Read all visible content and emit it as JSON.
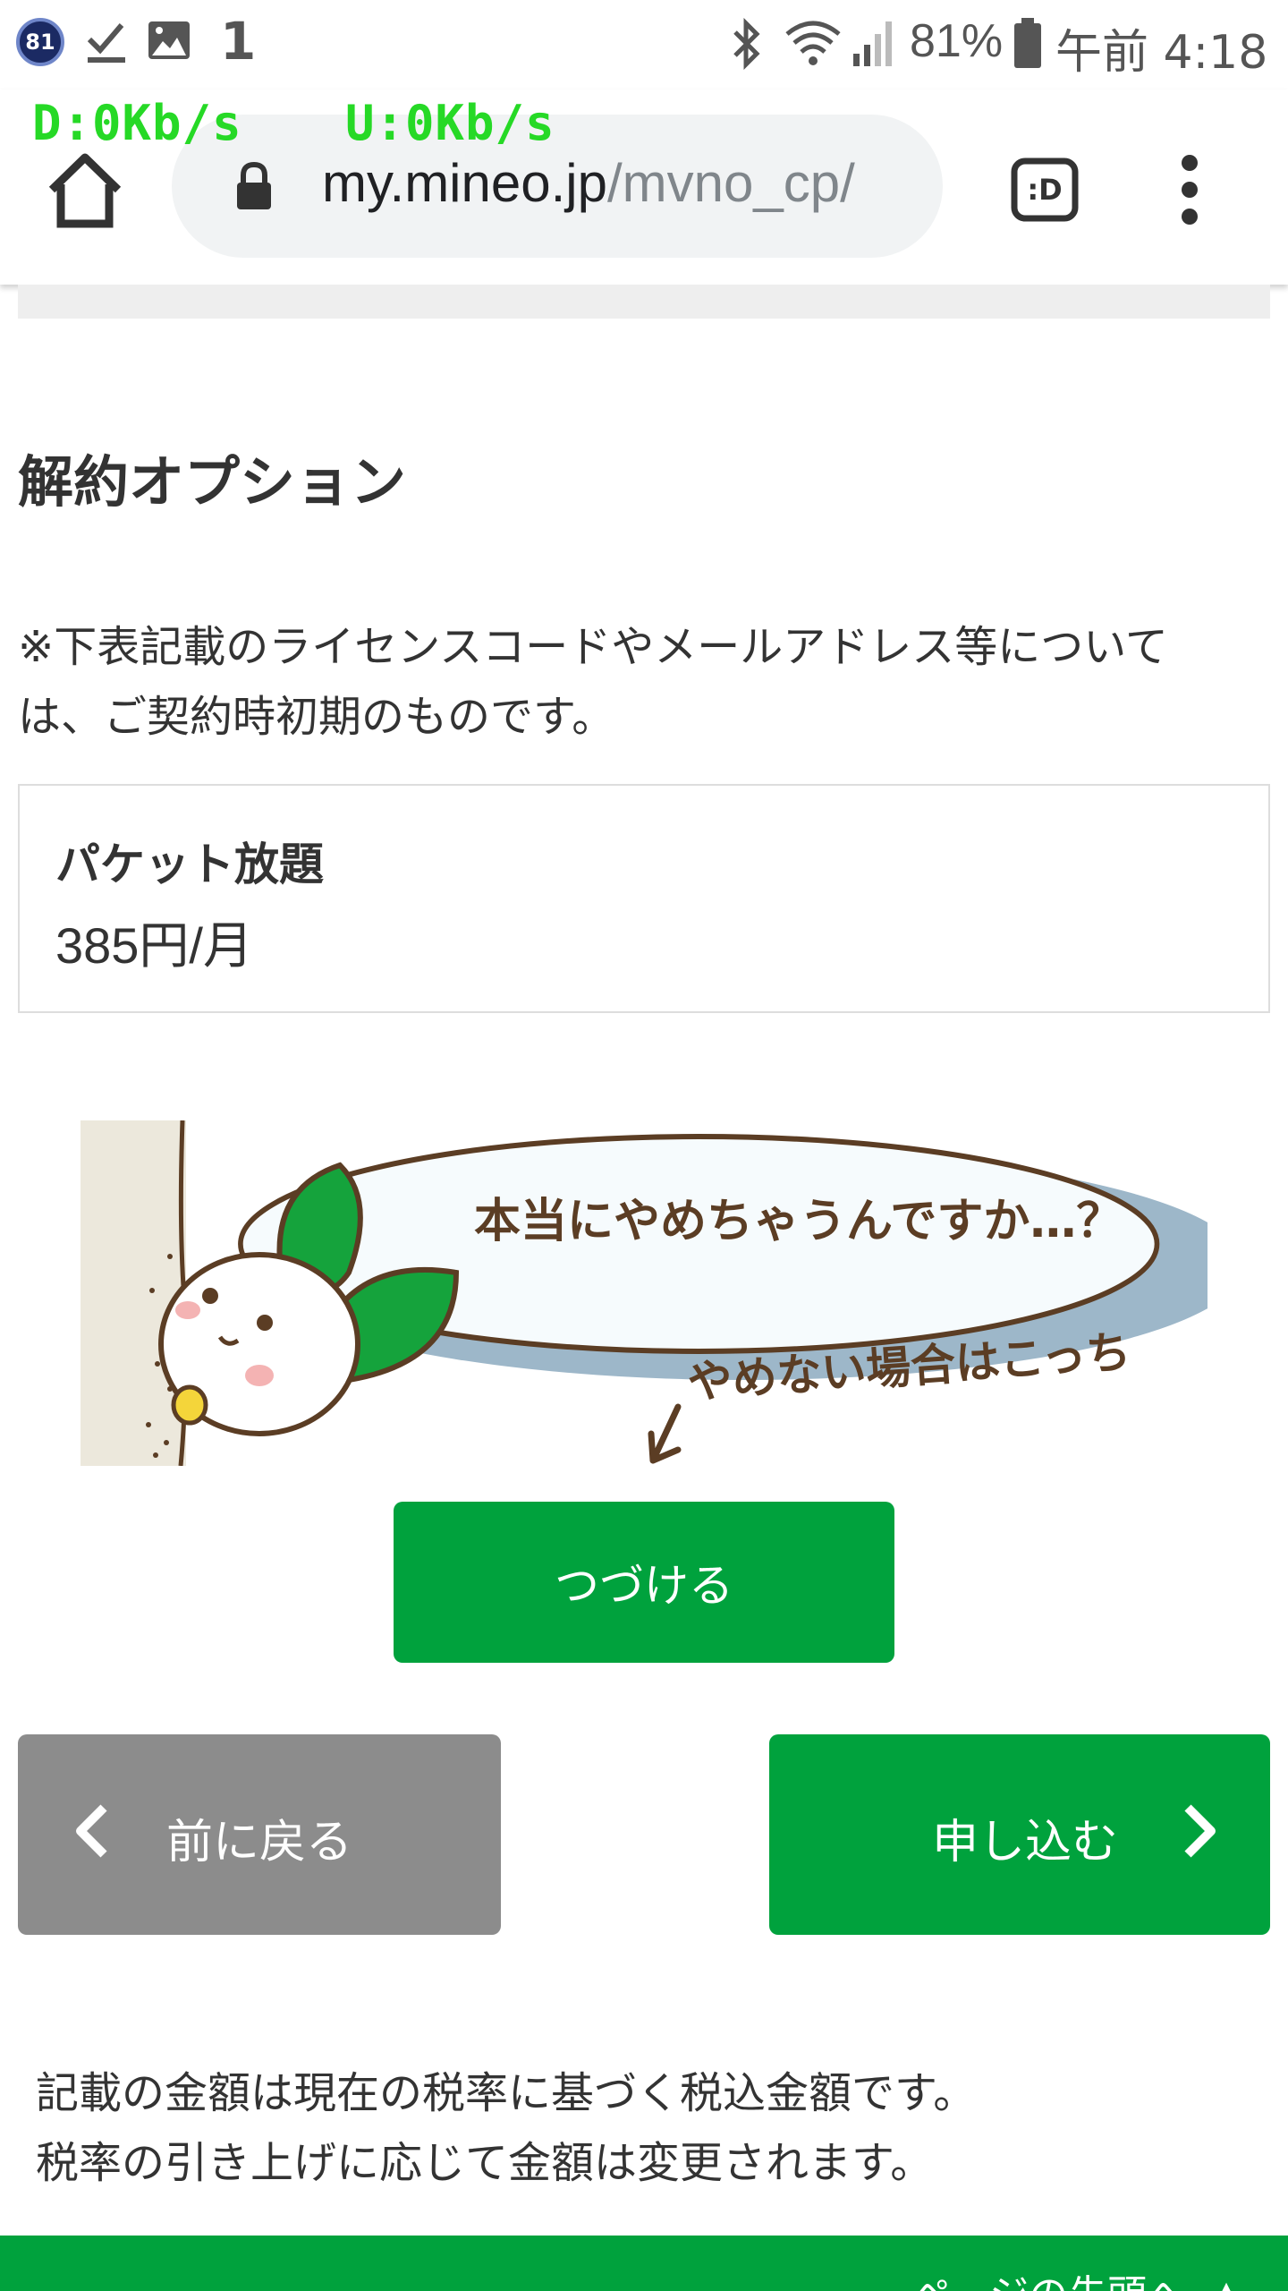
{
  "status_bar": {
    "badge": "81",
    "notification_count": "1",
    "battery": "81%",
    "time": "午前 4:18"
  },
  "net_speed": {
    "download": "D:0Kb/s",
    "upload": "U:0Kb/s"
  },
  "browser": {
    "url_host": "my.mineo.jp",
    "url_path": "/mvno_cp/",
    "tab_icon_label": ":D"
  },
  "page": {
    "section_title": "解約オプション",
    "note_line1": "※下表記載のライセンスコードやメールアドレス等について",
    "note_line2": "は、ご契約時初期のものです。",
    "option": {
      "name": "パケット放題",
      "price": "385円/月"
    },
    "illustration": {
      "speech": "本当にやめちゃうんですか…？",
      "hint": "やめない場合はこっち"
    },
    "continue_label": "つづける",
    "back_label": "前に戻る",
    "apply_label": "申し込む",
    "footnote_line1": "記載の金額は現在の税率に基づく税込金額です。",
    "footnote_line2": "税率の引き上げに応じて金額は変更されます。",
    "page_top_label": "ページの先頭へ"
  },
  "colors": {
    "brand_green": "#00a23d",
    "back_gray": "#8c8c8c",
    "net_overlay_green": "#26d926"
  },
  "icons": [
    "notification-badge-icon",
    "checkmark-icon",
    "image-icon",
    "bluetooth-icon",
    "wifi-icon",
    "signal-icon",
    "battery-icon",
    "home-icon",
    "lock-icon",
    "tab-switcher-icon",
    "more-vert-icon",
    "chevron-left-icon",
    "chevron-right-icon",
    "chevron-up-icon",
    "character-illustration"
  ]
}
